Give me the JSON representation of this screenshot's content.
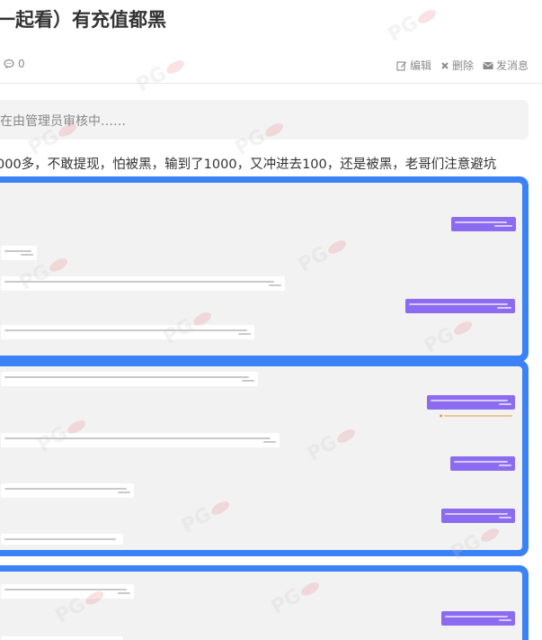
{
  "post": {
    "title": "一起看）有充值都黑",
    "comment_count": "0",
    "actions": {
      "edit": "编辑",
      "delete": "删除",
      "message": "发消息"
    },
    "notice": "在由管理员审核中……",
    "body": "000多，不敢提现，怕被黑，输到了1000，又冲进去100，还是被黑，老哥们注意避坑"
  },
  "icons": {
    "comment": "comment-icon",
    "edit": "edit-icon",
    "delete": "close-icon",
    "message": "envelope-icon"
  },
  "colors": {
    "frame": "#3b82f6",
    "bubble_right": "#8b6cf0",
    "muted": "#8a8a8a"
  },
  "watermark": "PG"
}
